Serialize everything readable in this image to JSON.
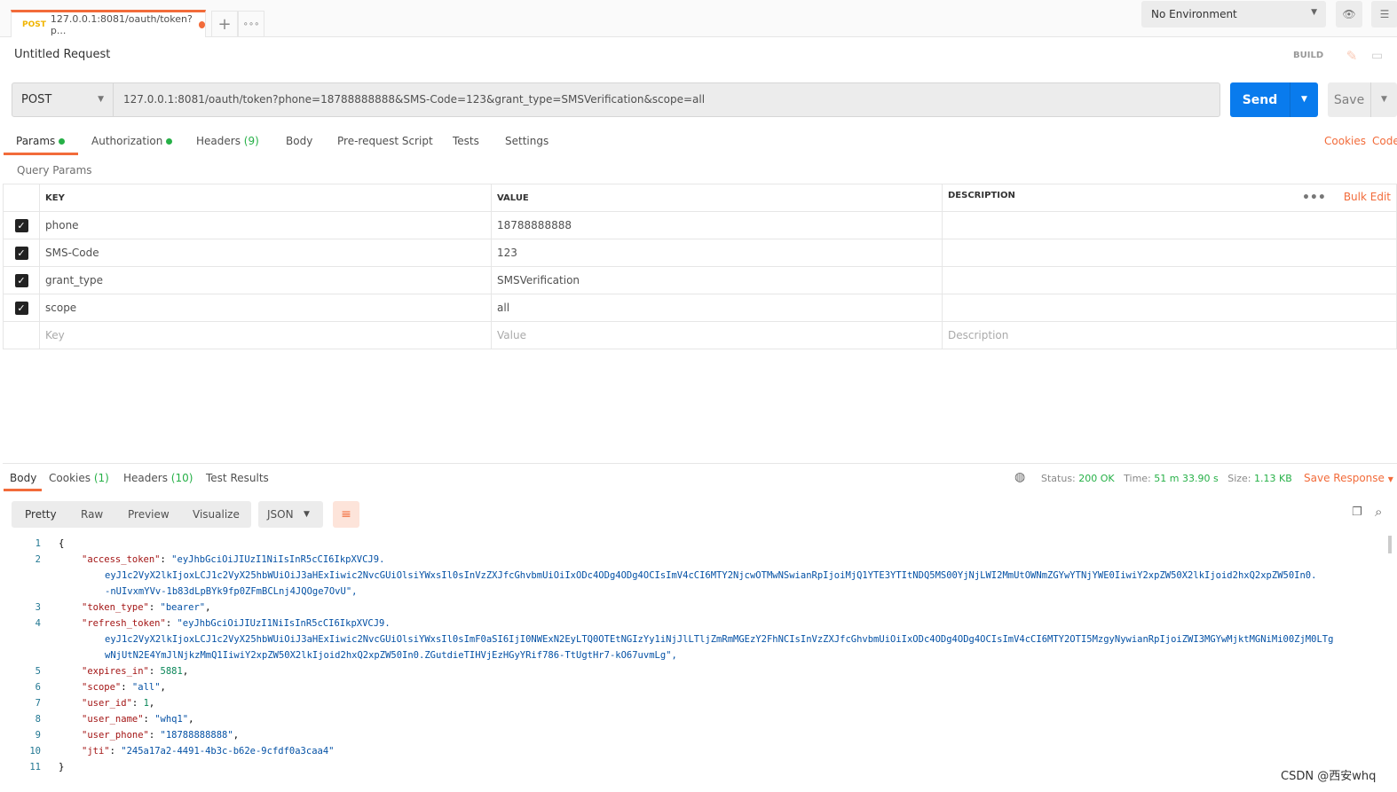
{
  "tab": {
    "method": "POST",
    "title": "127.0.0.1:8081/oauth/token?p..."
  },
  "environment": "No Environment",
  "request_name": "Untitled Request",
  "build_label": "BUILD",
  "request": {
    "method": "POST",
    "url": "127.0.0.1:8081/oauth/token?phone=18788888888&SMS-Code=123&grant_type=SMSVerification&scope=all"
  },
  "send_label": "Send",
  "save_label": "Save",
  "request_tabs": [
    {
      "label": "Params"
    },
    {
      "label": "Authorization"
    },
    {
      "label": "Headers",
      "count": "(9)"
    },
    {
      "label": "Body"
    },
    {
      "label": "Pre-request Script"
    },
    {
      "label": "Tests"
    },
    {
      "label": "Settings"
    }
  ],
  "cookies_link": "Cookies",
  "code_link": "Code",
  "query_params_title": "Query Params",
  "params_headers": {
    "key": "KEY",
    "value": "VALUE",
    "description": "DESCRIPTION",
    "bulk_edit": "Bulk Edit"
  },
  "params": [
    {
      "key": "phone",
      "value": "18788888888",
      "checked": true
    },
    {
      "key": "SMS-Code",
      "value": "123",
      "checked": true
    },
    {
      "key": "grant_type",
      "value": "SMSVerification",
      "checked": true
    },
    {
      "key": "scope",
      "value": "all",
      "checked": true
    }
  ],
  "placeholders": {
    "key": "Key",
    "value": "Value",
    "description": "Description"
  },
  "response_tabs": [
    {
      "label": "Body"
    },
    {
      "label": "Cookies",
      "count": "(1)"
    },
    {
      "label": "Headers",
      "count": "(10)"
    },
    {
      "label": "Test Results"
    }
  ],
  "status": {
    "status_label": "Status:",
    "status": "200 OK",
    "time_label": "Time:",
    "time": "51 m 33.90 s",
    "size_label": "Size:",
    "size": "1.13 KB",
    "save_response": "Save Response"
  },
  "view_modes": [
    "Pretty",
    "Raw",
    "Preview",
    "Visualize"
  ],
  "format": "JSON",
  "colors": {
    "accent": "#f26b3a",
    "send": "#097bed",
    "success": "#26b047"
  },
  "response_lines": [
    {
      "n": "1",
      "parts": [
        [
          "p",
          "{"
        ]
      ]
    },
    {
      "n": "2",
      "parts": [
        [
          "k",
          "\"access_token\""
        ],
        [
          "p",
          ": "
        ],
        [
          "s",
          "\"eyJhbGciOiJIUzI1NiIsInR5cCI6IkpXVCJ9."
        ]
      ],
      "cont": [
        "eyJ1c2VyX2lkIjoxLCJ1c2VyX25hbWUiOiJ3aHExIiwic2NvcGUiOlsiYWxsIl0sInVzZXJfcGhvbmUiOiIxODc4ODg4ODg4OCIsImV4cCI6MTY2NjcwOTMwNSwianRpIjoiMjQ1YTE3YTItNDQ5MS00YjNjLWI2MmUtOWNmZGYwYTNjYWE0IiwiY2xpZW50X2lkIjoid2hxQ2xpZW50In0.",
        "-nUIvxmYVv-1b83dLpBYk9fp0ZFmBCLnj4JQOge7OvU\","
      ]
    },
    {
      "n": "3",
      "parts": [
        [
          "k",
          "\"token_type\""
        ],
        [
          "p",
          ": "
        ],
        [
          "s",
          "\"bearer\""
        ],
        [
          "p",
          ","
        ]
      ]
    },
    {
      "n": "4",
      "parts": [
        [
          "k",
          "\"refresh_token\""
        ],
        [
          "p",
          ": "
        ],
        [
          "s",
          "\"eyJhbGciOiJIUzI1NiIsInR5cCI6IkpXVCJ9."
        ]
      ],
      "cont": [
        "eyJ1c2VyX2lkIjoxLCJ1c2VyX25hbWUiOiJ3aHExIiwic2NvcGUiOlsiYWxsIl0sImF0aSI6IjI0NWExN2EyLTQ0OTEtNGIzYy1iNjJlLTljZmRmMGEzY2FhNCIsInVzZXJfcGhvbmUiOiIxODc4ODg4ODg4OCIsImV4cCI6MTY2OTI5MzgyNywianRpIjoiZWI3MGYwMjktMGNiMi00ZjM0LTg",
        "wNjUtN2E4YmJlNjkzMmQ1IiwiY2xpZW50X2lkIjoid2hxQ2xpZW50In0.ZGutdieTIHVjEzHGyYRif786-TtUgtHr7-kO67uvmLg\","
      ]
    },
    {
      "n": "5",
      "parts": [
        [
          "k",
          "\"expires_in\""
        ],
        [
          "p",
          ": "
        ],
        [
          "n",
          "5881"
        ],
        [
          "p",
          ","
        ]
      ]
    },
    {
      "n": "6",
      "parts": [
        [
          "k",
          "\"scope\""
        ],
        [
          "p",
          ": "
        ],
        [
          "s",
          "\"all\""
        ],
        [
          "p",
          ","
        ]
      ]
    },
    {
      "n": "7",
      "parts": [
        [
          "k",
          "\"user_id\""
        ],
        [
          "p",
          ": "
        ],
        [
          "n",
          "1"
        ],
        [
          "p",
          ","
        ]
      ]
    },
    {
      "n": "8",
      "parts": [
        [
          "k",
          "\"user_name\""
        ],
        [
          "p",
          ": "
        ],
        [
          "s",
          "\"whq1\""
        ],
        [
          "p",
          ","
        ]
      ]
    },
    {
      "n": "9",
      "parts": [
        [
          "k",
          "\"user_phone\""
        ],
        [
          "p",
          ": "
        ],
        [
          "s",
          "\"18788888888\""
        ],
        [
          "p",
          ","
        ]
      ]
    },
    {
      "n": "10",
      "parts": [
        [
          "k",
          "\"jti\""
        ],
        [
          "p",
          ": "
        ],
        [
          "s",
          "\"245a17a2-4491-4b3c-b62e-9cfdf0a3caa4\""
        ]
      ]
    },
    {
      "n": "11",
      "parts": [
        [
          "p",
          "}"
        ]
      ]
    }
  ],
  "watermark": "CSDN @西安whq"
}
